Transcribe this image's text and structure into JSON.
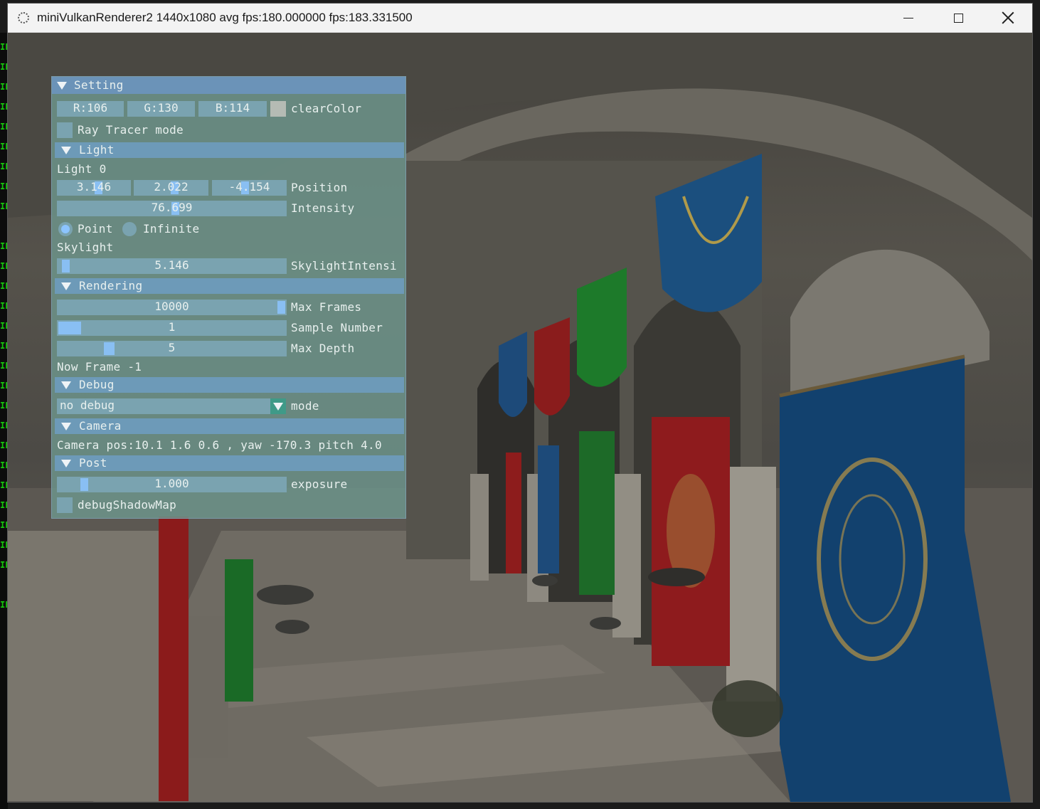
{
  "window": {
    "title": "miniVulkanRenderer2 1440x1080 avg fps:180.000000 fps:183.331500"
  },
  "console_strip": {
    "glyph": "IF"
  },
  "imgui": {
    "title": "Setting",
    "clear_color": {
      "r": "R:106",
      "g": "G:130",
      "b": "B:114",
      "label": "clearColor",
      "swatch_color": "#b5bbb4"
    },
    "ray_tracer_mode": "Ray Tracer mode",
    "light": {
      "header": "Light",
      "light0": "Light 0",
      "pos_x": "3.146",
      "pos_y": "2.022",
      "pos_z": "-4.154",
      "position_label": "Position",
      "intensity_value": "76.699",
      "intensity_label": "Intensity",
      "radio_point": "Point",
      "radio_infinite": "Infinite",
      "selected": "Point",
      "skylight": "Skylight",
      "skylight_value": "5.146",
      "skylight_label": "SkylightIntensi"
    },
    "rendering": {
      "header": "Rendering",
      "max_frames_value": "10000",
      "max_frames_label": "Max Frames",
      "sample_value": "1",
      "sample_label": "Sample Number",
      "depth_value": "5",
      "depth_label": "Max Depth",
      "now_frame": "Now Frame -1"
    },
    "debug": {
      "header": "Debug",
      "mode_value": "no debug",
      "mode_label": "mode"
    },
    "camera": {
      "header": "Camera",
      "info": "Camera pos:10.1 1.6 0.6 , yaw -170.3 pitch 4.0"
    },
    "post": {
      "header": "Post",
      "exposure_value": "1.000",
      "exposure_label": "exposure",
      "debug_shadow": "debugShadowMap"
    }
  },
  "colors": {
    "title_bar": "#6b93b8",
    "header": "#6d9ab8",
    "frame": "#7aa3b0",
    "grab": "#8cc4ff",
    "combo_arrow": "#3f9a88"
  }
}
